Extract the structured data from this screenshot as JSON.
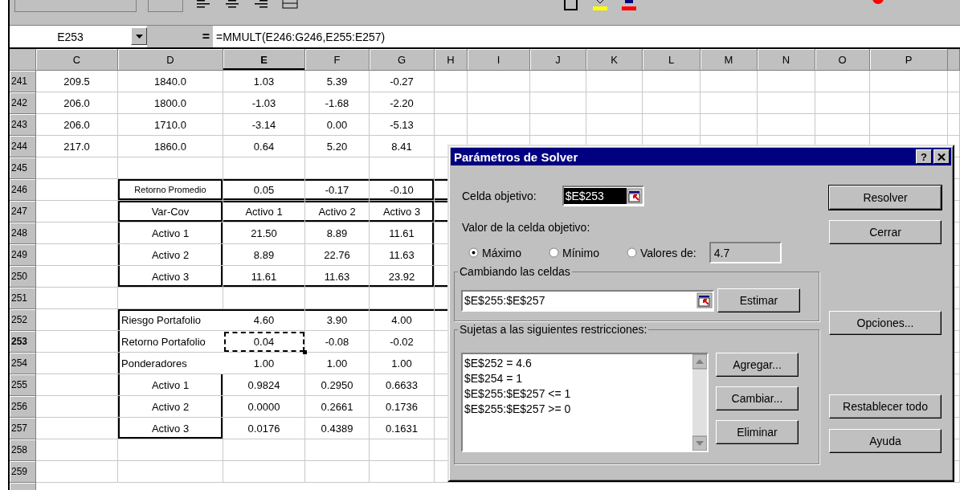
{
  "formula_bar": {
    "name_box": "E253",
    "equals": "=",
    "formula": "=MMULT(E246:G246,E255:E257)"
  },
  "columns": [
    {
      "label": "C",
      "selected": false
    },
    {
      "label": "D",
      "selected": false
    },
    {
      "label": "E",
      "selected": true
    },
    {
      "label": "F",
      "selected": false
    },
    {
      "label": "G",
      "selected": false
    },
    {
      "label": "H",
      "selected": false
    },
    {
      "label": "I",
      "selected": false
    },
    {
      "label": "J",
      "selected": false
    },
    {
      "label": "K",
      "selected": false
    },
    {
      "label": "L",
      "selected": false
    },
    {
      "label": "M",
      "selected": false
    },
    {
      "label": "N",
      "selected": false
    },
    {
      "label": "O",
      "selected": false
    },
    {
      "label": "P",
      "selected": false
    }
  ],
  "rows": [
    {
      "number": "241",
      "selected": false,
      "cells": [
        "209.5",
        "1840.0",
        "1.03",
        "5.39",
        "-0.27"
      ]
    },
    {
      "number": "242",
      "selected": false,
      "cells": [
        "206.0",
        "1800.0",
        "-1.03",
        "-1.68",
        "-2.20"
      ]
    },
    {
      "number": "243",
      "selected": false,
      "cells": [
        "206.0",
        "1710.0",
        "-3.14",
        "0.00",
        "-5.13"
      ]
    },
    {
      "number": "244",
      "selected": false,
      "cells": [
        "217.0",
        "1860.0",
        "0.64",
        "5.20",
        "8.41"
      ]
    },
    {
      "number": "245",
      "selected": false,
      "cells": [
        null,
        null,
        null,
        null,
        null
      ]
    },
    {
      "number": "246",
      "selected": false,
      "cells": [
        null,
        "Retorno Promedio",
        "0.05",
        "-0.17",
        "-0.10"
      ]
    },
    {
      "number": "247",
      "selected": false,
      "cells": [
        null,
        "Var-Cov",
        "Activo 1",
        "Activo 2",
        "Activo 3"
      ]
    },
    {
      "number": "248",
      "selected": false,
      "cells": [
        null,
        "Activo 1",
        "21.50",
        "8.89",
        "11.61"
      ]
    },
    {
      "number": "249",
      "selected": false,
      "cells": [
        null,
        "Activo 2",
        "8.89",
        "22.76",
        "11.63"
      ]
    },
    {
      "number": "250",
      "selected": false,
      "cells": [
        null,
        "Activo 3",
        "11.61",
        "11.63",
        "23.92"
      ]
    },
    {
      "number": "251",
      "selected": false,
      "cells": [
        null,
        null,
        null,
        null,
        null
      ]
    },
    {
      "number": "252",
      "selected": false,
      "cells": [
        null,
        "Riesgo Portafolio",
        "4.60",
        "3.90",
        "4.00"
      ]
    },
    {
      "number": "253",
      "selected": true,
      "cells": [
        null,
        "Retorno Portafolio",
        "0.04",
        "-0.08",
        "-0.02"
      ]
    },
    {
      "number": "254",
      "selected": false,
      "cells": [
        null,
        "Ponderadores",
        "1.00",
        "1.00",
        "1.00"
      ]
    },
    {
      "number": "255",
      "selected": false,
      "cells": [
        null,
        "Activo 1",
        "0.9824",
        "0.2950",
        "0.6633"
      ]
    },
    {
      "number": "256",
      "selected": false,
      "cells": [
        null,
        "Activo 2",
        "0.0000",
        "0.2661",
        "0.1736"
      ]
    },
    {
      "number": "257",
      "selected": false,
      "cells": [
        null,
        "Activo 3",
        "0.0176",
        "0.4389",
        "0.1631"
      ]
    },
    {
      "number": "258",
      "selected": false,
      "cells": [
        null,
        null,
        null,
        null,
        null
      ]
    },
    {
      "number": "259",
      "selected": false,
      "cells": [
        null,
        null,
        null,
        null,
        null
      ]
    }
  ],
  "dialog": {
    "title": "Parámetros de Solver",
    "help_button": "?",
    "target_cell": {
      "label": "Celda objetivo:",
      "value": "$E$253"
    },
    "value_label": "Valor de la celda objetivo:",
    "options": [
      {
        "label": "Máximo",
        "selected": true
      },
      {
        "label": "Mínimo",
        "selected": false
      },
      {
        "label": "Valores de:",
        "selected": false
      }
    ],
    "value_field": "4.7",
    "changing": {
      "legend": "Cambiando las celdas",
      "value": "$E$255:$E$257",
      "button": "Estimar"
    },
    "constraints": {
      "legend": "Sujetas a las siguientes restricciones:",
      "items": [
        "$E$252 = 4.6",
        "$E$254 = 1",
        "$E$255:$E$257 <= 1",
        "$E$255:$E$257 >= 0"
      ],
      "buttons": [
        "Agregar...",
        "Cambiar...",
        "Eliminar"
      ]
    },
    "side_buttons": [
      {
        "label": "Resolver",
        "default": true
      },
      {
        "label": "Cerrar",
        "default": false
      },
      {
        "label": "Opciones...",
        "default": false
      },
      {
        "label": "Restablecer todo",
        "default": false
      },
      {
        "label": "Ayuda",
        "default": false
      }
    ]
  }
}
